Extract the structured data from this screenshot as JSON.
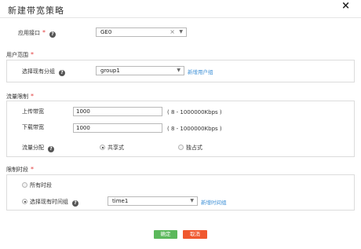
{
  "dialog": {
    "title": "新建带宽策略",
    "close_symbol": "×"
  },
  "interface": {
    "label": "应用接口",
    "value": "GE0",
    "clear_symbol": "×"
  },
  "user_scope": {
    "section_label": "用户范围",
    "field_label": "选择现有分组",
    "value": "group1",
    "new_link": "新增用户组"
  },
  "flow_limit": {
    "section_label": "流量限制",
    "upload_label": "上传带宽",
    "upload_value": "1000",
    "upload_hint": "( 8 - 1000000Kbps )",
    "download_label": "下载带宽",
    "download_value": "1000",
    "download_hint": "( 8 - 1000000Kbps )",
    "alloc_label": "流量分配",
    "shared_label": "共享式",
    "exclusive_label": "独占式"
  },
  "time_limit": {
    "section_label": "限制时段",
    "all_label": "所有时段",
    "existing_label": "选择现有时间组",
    "value": "time1",
    "new_link": "新增时间组"
  },
  "actions": {
    "confirm_label": "确定",
    "cancel_label": "取消"
  },
  "colors": {
    "confirm": "#5cb85c",
    "cancel": "#f0582f",
    "link": "#3c8fd6",
    "required": "#e23c3c"
  }
}
